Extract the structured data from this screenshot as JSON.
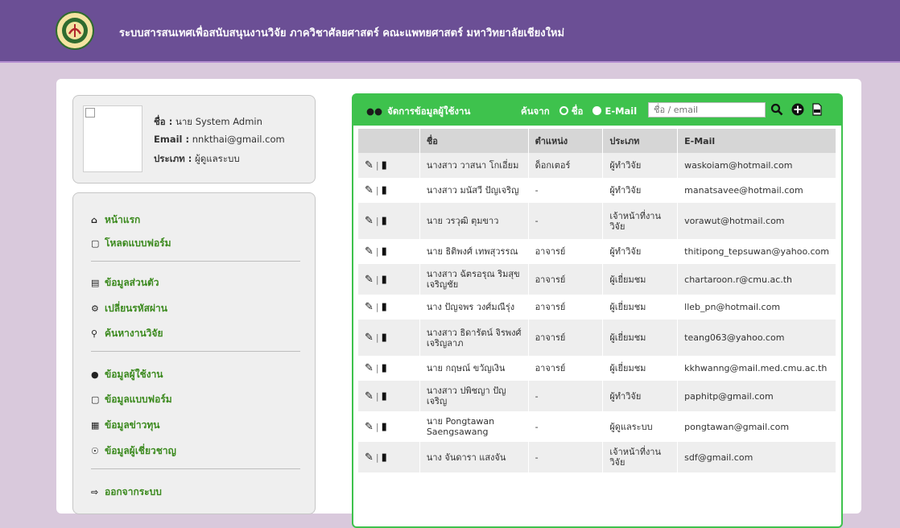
{
  "header": {
    "title": "ระบบสารสนเทศเพื่อสนับสนุนงานวิจัย ภาควิชาศัลยศาสตร์ คณะแพทยศาสตร์ มหาวิทยาลัยเชียงใหม่"
  },
  "profile": {
    "name_label": "ชื่อ :",
    "name_value": "นาย System Admin",
    "email_label": "Email :",
    "email_value": "nnkthai@gmail.com",
    "type_label": "ประเภท :",
    "type_value": "ผู้ดูแลระบบ"
  },
  "menu": {
    "home": "หน้าแรก",
    "download": "โหลดแบบฟอร์ม",
    "personal": "ข้อมูลส่วนตัว",
    "password": "เปลี่ยนรหัสผ่าน",
    "search": "ค้นหางานวิจัย",
    "users": "ข้อมูลผู้ใช้งาน",
    "forms": "ข้อมูลแบบฟอร์ม",
    "news": "ข้อมูลข่าวทุน",
    "experts": "ข้อมูลผู้เชี่ยวชาญ",
    "logout": "ออกจากระบบ"
  },
  "users_panel": {
    "title": "จัดการข้อมูลผู้ใช้งาน",
    "search_by": "ค้นจาก",
    "opt_name": "ชื่อ",
    "opt_email": "E-Mail",
    "search_placeholder": "ชื่อ / email",
    "columns": [
      "",
      "ชื่อ",
      "ตำแหน่ง",
      "ประเภท",
      "E-Mail"
    ],
    "rows": [
      {
        "name": "นางสาว วาสนา โกเอี่ยม",
        "position": "ด็อกเตอร์",
        "type": "ผู้ทำวิจัย",
        "email": "waskoiam@hotmail.com"
      },
      {
        "name": "นางสาว มนัสวี ปัญเจริญ",
        "position": "-",
        "type": "ผู้ทำวิจัย",
        "email": "manatsavee@hotmail.com"
      },
      {
        "name": "นาย วรวุฒิ ตุมขาว",
        "position": "-",
        "type": "เจ้าหน้าที่งานวิจัย",
        "email": "vorawut@hotmail.com"
      },
      {
        "name": "นาย ธิติพงศ์ เทพสุวรรณ",
        "position": "อาจารย์",
        "type": "ผู้ทำวิจัย",
        "email": "thitipong_tepsuwan@yahoo.com"
      },
      {
        "name": "นางสาว ฉัตรอรุณ ริมสุข เจริญชัย",
        "position": "อาจารย์",
        "type": "ผู้เยี่ยมชม",
        "email": "chartaroon.r@cmu.ac.th"
      },
      {
        "name": "นาง ปัญจพร วงศ์มณีรุ่ง",
        "position": "อาจารย์",
        "type": "ผู้เยี่ยมชม",
        "email": "lleb_pn@hotmail.com"
      },
      {
        "name": "นางสาว ธิดารัตน์ จิรพงศ์เจริญลาภ",
        "position": "อาจารย์",
        "type": "ผู้เยี่ยมชม",
        "email": "teang063@yahoo.com"
      },
      {
        "name": "นาย กฤษณ์ ขวัญเงิน",
        "position": "อาจารย์",
        "type": "ผู้เยี่ยมชม",
        "email": "kkhwanng@mail.med.cmu.ac.th"
      },
      {
        "name": "นางสาว ปพิชญา ปัญเจริญ",
        "position": "-",
        "type": "ผู้ทำวิจัย",
        "email": "paphitp@gmail.com"
      },
      {
        "name": "นาย Pongtawan Saengsawang",
        "position": "-",
        "type": "ผู้ดูแลระบบ",
        "email": "pongtawan@gmail.com"
      },
      {
        "name": "นาง จันดารา แสงจัน",
        "position": "-",
        "type": "เจ้าหน้าที่งานวิจัย",
        "email": "sdf@gmail.com"
      }
    ]
  },
  "colors": {
    "header": "#6b4f95",
    "accent": "#3ec24d",
    "menu_text": "#3c8a1f"
  },
  "icons": [
    "users-icon",
    "search-icon",
    "add-icon",
    "pdf-icon",
    "edit-icon",
    "delete-icon",
    "home-icon",
    "folder-icon",
    "id-card-icon",
    "gear-icon",
    "newspaper-icon",
    "expert-icon",
    "logout-icon"
  ]
}
